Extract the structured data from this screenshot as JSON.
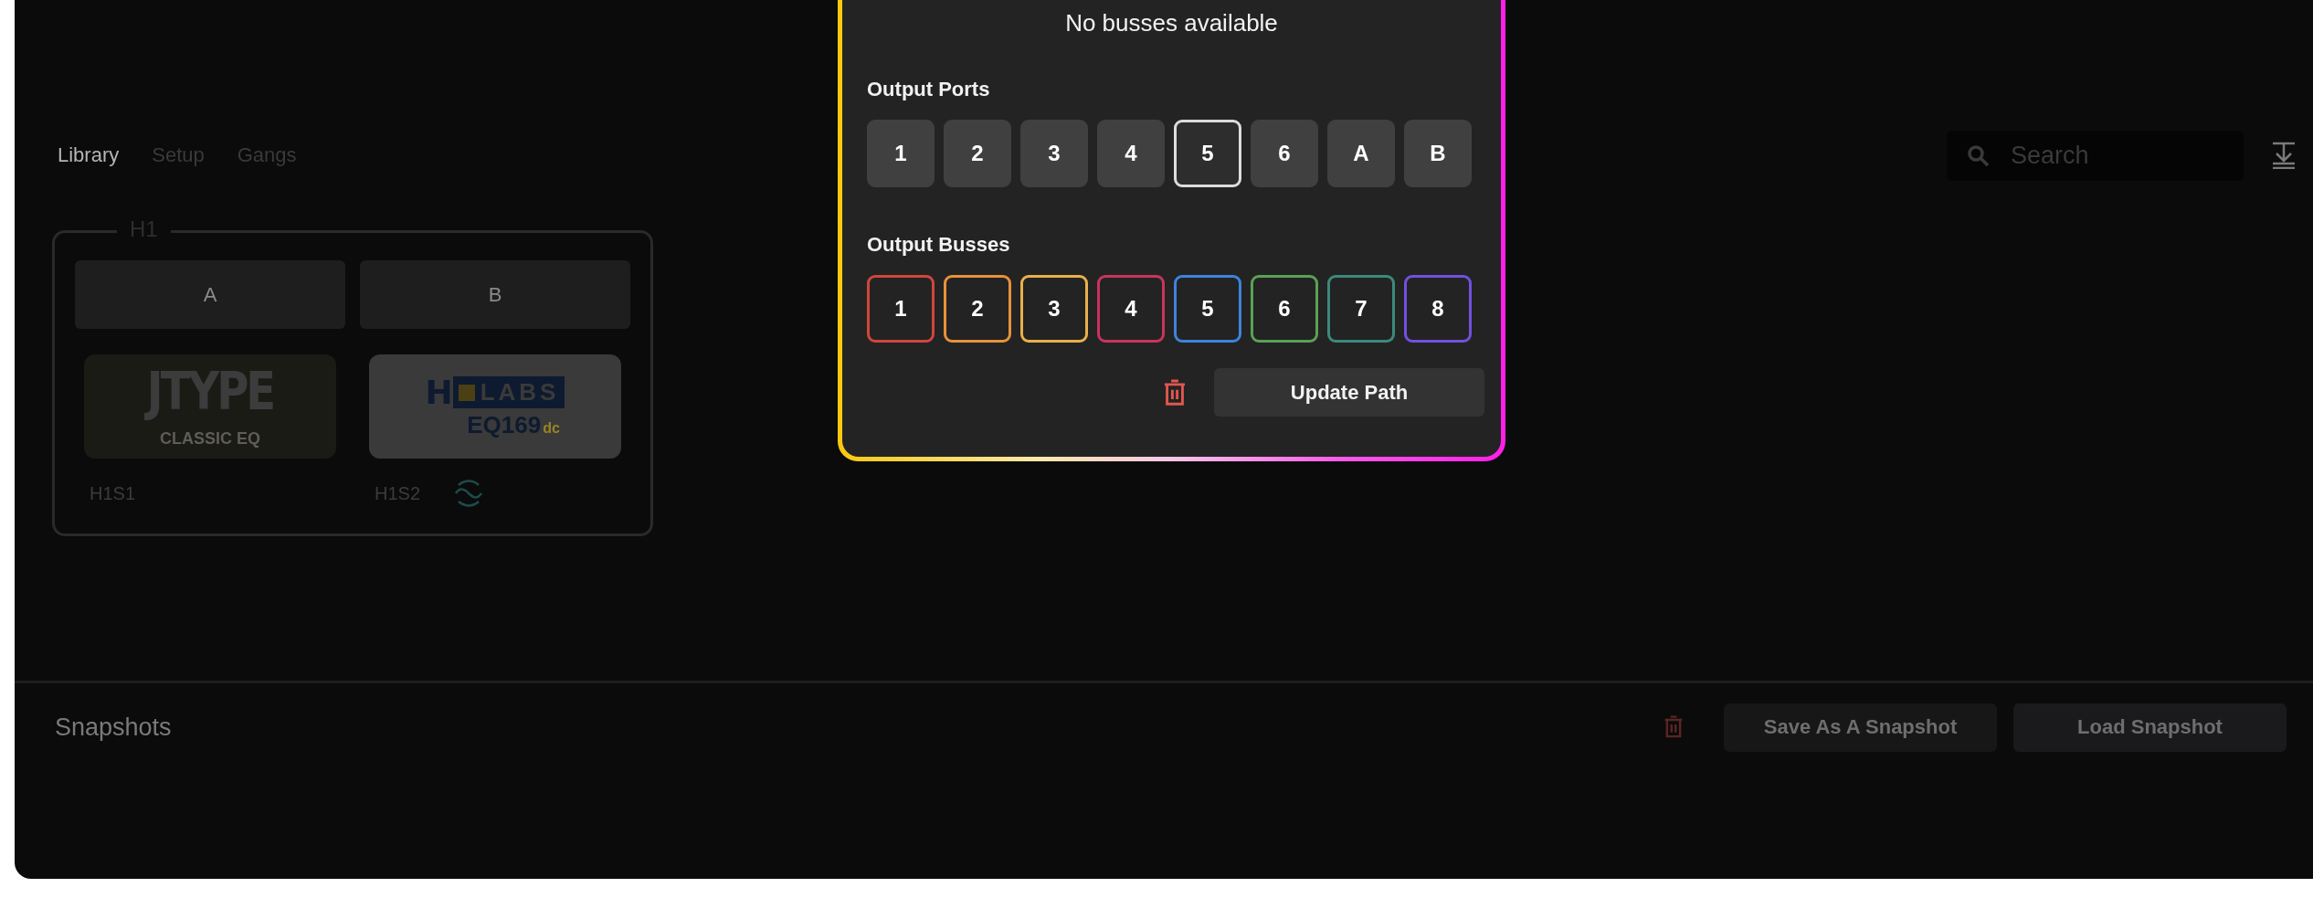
{
  "tabs": [
    {
      "label": "Library",
      "selected": true
    },
    {
      "label": "Setup",
      "selected": false
    },
    {
      "label": "Gangs",
      "selected": false
    }
  ],
  "search": {
    "placeholder": "Search"
  },
  "groups": [
    {
      "title": "H1",
      "slots": [
        {
          "label": "A"
        },
        {
          "label": "B"
        }
      ],
      "plugins": [
        {
          "kind": "jtype",
          "logo": "JTYPE",
          "subtitle": "CLASSIC EQ",
          "name": "H1S1",
          "wave": false
        },
        {
          "kind": "holabs",
          "logo_letter": "H",
          "logo": "LABS",
          "subtitle": "EQ169",
          "suffix": "dc",
          "name": "H1S2",
          "wave": true
        }
      ]
    }
  ],
  "modal": {
    "message": "No busses available",
    "ports": {
      "title": "Output Ports",
      "items": [
        {
          "label": "1",
          "selected": false
        },
        {
          "label": "2",
          "selected": false
        },
        {
          "label": "3",
          "selected": false
        },
        {
          "label": "4",
          "selected": false
        },
        {
          "label": "5",
          "selected": true
        },
        {
          "label": "6",
          "selected": false
        },
        {
          "label": "A",
          "selected": false
        },
        {
          "label": "B",
          "selected": false
        }
      ]
    },
    "busses": {
      "title": "Output Busses",
      "items": [
        {
          "label": "1",
          "color": "#d0463c"
        },
        {
          "label": "2",
          "color": "#e8913a"
        },
        {
          "label": "3",
          "color": "#e9b04a"
        },
        {
          "label": "4",
          "color": "#c8345e"
        },
        {
          "label": "5",
          "color": "#3d84dc"
        },
        {
          "label": "6",
          "color": "#5aa154"
        },
        {
          "label": "7",
          "color": "#3b8a7c"
        },
        {
          "label": "8",
          "color": "#7250e0"
        }
      ]
    },
    "update_button": "Update Path"
  },
  "snapshots": {
    "title": "Snapshots",
    "buttons": [
      "Save As A Snapshot",
      "Load Snapshot"
    ]
  }
}
